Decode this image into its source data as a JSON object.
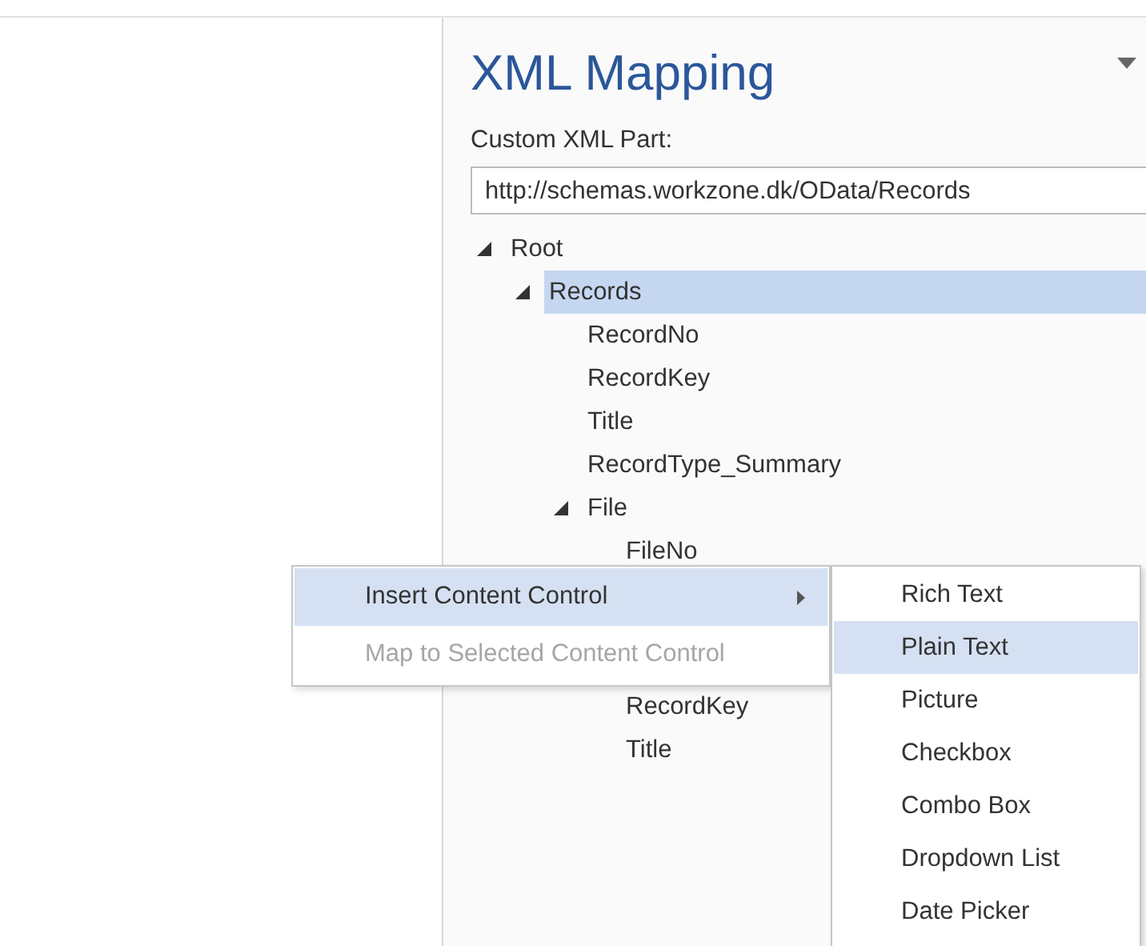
{
  "pane": {
    "title": "XML Mapping",
    "part_label": "Custom XML Part:",
    "part_value": "http://schemas.workzone.dk/OData/Records"
  },
  "tree": [
    {
      "label": "Root",
      "expanded": true,
      "selected": false,
      "children": [
        {
          "label": "Records",
          "expanded": true,
          "selected": true,
          "children": [
            {
              "label": "RecordNo",
              "selected": false
            },
            {
              "label": "RecordKey",
              "selected": false
            },
            {
              "label": "Title",
              "selected": false
            },
            {
              "label": "RecordType_Summary",
              "selected": false
            },
            {
              "label": "File",
              "expanded": true,
              "selected": false,
              "children": [
                {
                  "label": "FileNo",
                  "selected": false
                },
                {
                  "label": "RecordKey",
                  "selected": false
                },
                {
                  "label": "Title",
                  "selected": false
                }
              ]
            }
          ]
        }
      ]
    }
  ],
  "context_menu": [
    {
      "label": "Insert Content Control",
      "selected": true,
      "disabled": false,
      "submenu": true
    },
    {
      "label": "Map to Selected Content Control",
      "selected": false,
      "disabled": true,
      "submenu": false
    }
  ],
  "submenu": [
    {
      "label": "Rich Text",
      "selected": false
    },
    {
      "label": "Plain Text",
      "selected": true
    },
    {
      "label": "Picture",
      "selected": false
    },
    {
      "label": "Checkbox",
      "selected": false
    },
    {
      "label": "Combo Box",
      "selected": false
    },
    {
      "label": "Dropdown List",
      "selected": false
    },
    {
      "label": "Date Picker",
      "selected": false
    }
  ]
}
